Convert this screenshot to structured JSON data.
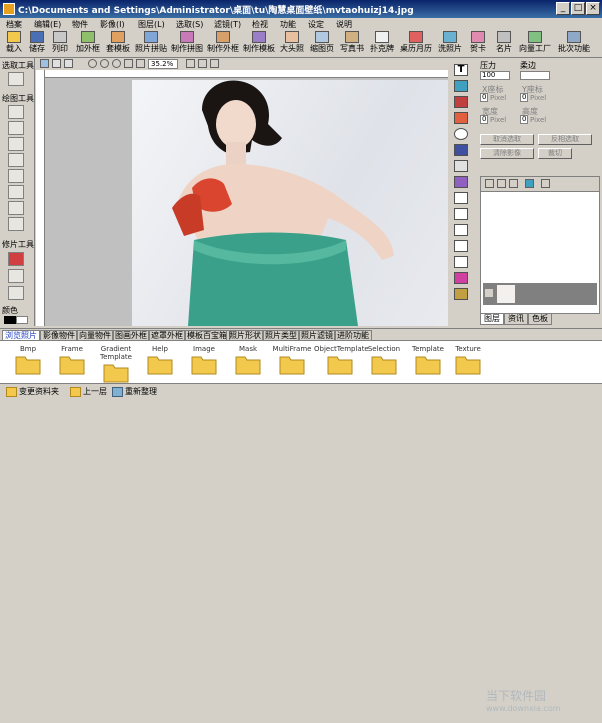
{
  "window": {
    "title": "C:\\Documents and Settings\\Administrator\\桌面\\tu\\陶慧桌面壁纸\\mvtaohuizj14.jpg",
    "minimize": "_",
    "maximize": "□",
    "close": "×"
  },
  "menu": [
    "档案",
    "编辑(E)",
    "物件",
    "影像(I)",
    "图层(L)",
    "选取(S)",
    "滤镜(T)",
    "检视",
    "功能",
    "设定",
    "说明"
  ],
  "toolbar": [
    "载入",
    "储存",
    "列印",
    "加外框",
    "套模板",
    "照片拼贴",
    "制作拼图",
    "制作外框",
    "制作模板",
    "大头照",
    "缩图页",
    "写真书",
    "扑克牌",
    "桌历月历",
    "洗照片",
    "贺卡",
    "名片",
    "向量工厂",
    "批次功能"
  ],
  "left_panel": {
    "select_tools": "选取工具",
    "paint_tools": "绘图工具",
    "retouch_tools": "修片工具",
    "color": "颜色"
  },
  "canvas": {
    "zoom": "35.2%"
  },
  "properties": {
    "pressure": "压力",
    "softness": "柔边",
    "pressure_value": "100",
    "fields": [
      {
        "label": "X座标",
        "value": "0",
        "unit": "Pixel"
      },
      {
        "label": "Y座标",
        "value": "0",
        "unit": "Pixel"
      },
      {
        "label": "宽度",
        "value": "0",
        "unit": "Pixel"
      },
      {
        "label": "高度",
        "value": "0",
        "unit": "Pixel"
      }
    ],
    "cancel_select": "取消选取",
    "invert_select": "反相选取",
    "clear_image": "清除影像",
    "crop": "裁切"
  },
  "right_tabs": [
    "图层",
    "资讯",
    "色板"
  ],
  "bottom_tabs": [
    "浏览照片",
    "影像物件",
    "向量物件",
    "图画外框",
    "遮罩外框",
    "模板百宝箱",
    "照片形状",
    "照片类型",
    "照片滤镜",
    "进阶功能"
  ],
  "folders": [
    "Bmp",
    "Frame",
    "Gradient Template",
    "Help",
    "Image",
    "Mask",
    "MultiFrame",
    "ObjectTemplate",
    "Selection",
    "Template",
    "Texture"
  ],
  "status": {
    "change_folder": "变更资料夹",
    "up_level": "上一层",
    "refresh": "重新整理"
  },
  "watermark": {
    "brand": "当下软件园",
    "url": "www.downxia.com"
  },
  "colors": {
    "titlebar": "#0a246a",
    "face": "#d4d0c8",
    "folder": "#f2c94c",
    "dress": "#3aa08a",
    "glove": "#d9452e"
  }
}
